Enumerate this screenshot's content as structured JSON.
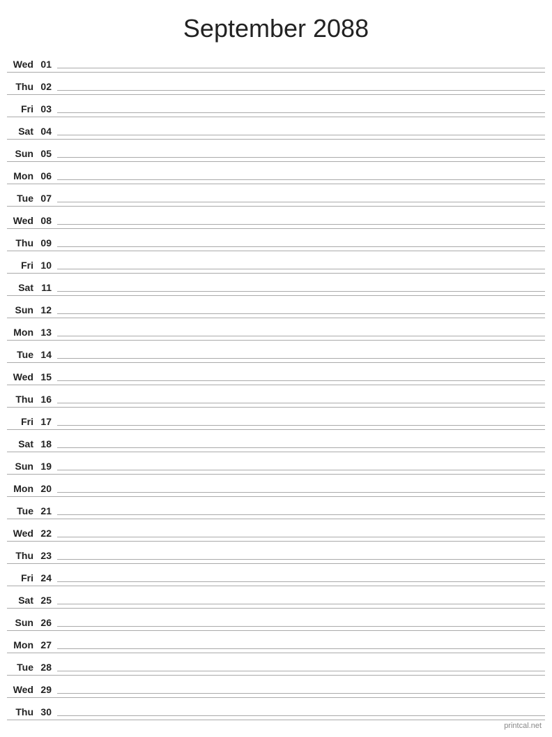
{
  "title": "September 2088",
  "footer": "printcal.net",
  "days": [
    {
      "name": "Wed",
      "number": "01"
    },
    {
      "name": "Thu",
      "number": "02"
    },
    {
      "name": "Fri",
      "number": "03"
    },
    {
      "name": "Sat",
      "number": "04"
    },
    {
      "name": "Sun",
      "number": "05"
    },
    {
      "name": "Mon",
      "number": "06"
    },
    {
      "name": "Tue",
      "number": "07"
    },
    {
      "name": "Wed",
      "number": "08"
    },
    {
      "name": "Thu",
      "number": "09"
    },
    {
      "name": "Fri",
      "number": "10"
    },
    {
      "name": "Sat",
      "number": "11"
    },
    {
      "name": "Sun",
      "number": "12"
    },
    {
      "name": "Mon",
      "number": "13"
    },
    {
      "name": "Tue",
      "number": "14"
    },
    {
      "name": "Wed",
      "number": "15"
    },
    {
      "name": "Thu",
      "number": "16"
    },
    {
      "name": "Fri",
      "number": "17"
    },
    {
      "name": "Sat",
      "number": "18"
    },
    {
      "name": "Sun",
      "number": "19"
    },
    {
      "name": "Mon",
      "number": "20"
    },
    {
      "name": "Tue",
      "number": "21"
    },
    {
      "name": "Wed",
      "number": "22"
    },
    {
      "name": "Thu",
      "number": "23"
    },
    {
      "name": "Fri",
      "number": "24"
    },
    {
      "name": "Sat",
      "number": "25"
    },
    {
      "name": "Sun",
      "number": "26"
    },
    {
      "name": "Mon",
      "number": "27"
    },
    {
      "name": "Tue",
      "number": "28"
    },
    {
      "name": "Wed",
      "number": "29"
    },
    {
      "name": "Thu",
      "number": "30"
    }
  ]
}
